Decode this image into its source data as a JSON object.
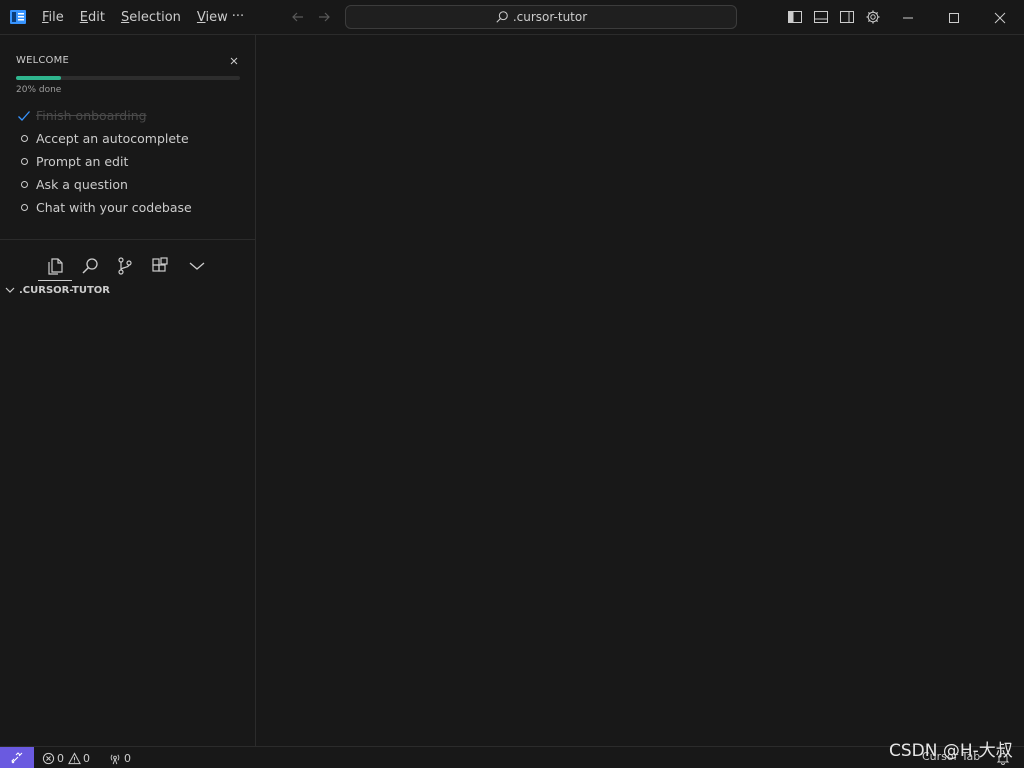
{
  "titlebar": {
    "menu": [
      {
        "accel": "F",
        "rest": "ile"
      },
      {
        "accel": "E",
        "rest": "dit"
      },
      {
        "accel": "S",
        "rest": "election"
      },
      {
        "accel": "V",
        "rest": "iew"
      }
    ],
    "more_label": "···",
    "search_text": ".cursor-tutor"
  },
  "welcome": {
    "title": "WELCOME",
    "progress_percent": 20,
    "progress_text": "20% done",
    "tasks": [
      {
        "label": "Finish onboarding",
        "done": true
      },
      {
        "label": "Accept an autocomplete",
        "done": false
      },
      {
        "label": "Prompt an edit",
        "done": false
      },
      {
        "label": "Ask a question",
        "done": false
      },
      {
        "label": "Chat with your codebase",
        "done": false
      }
    ]
  },
  "explorer": {
    "folder_name": ".CURSOR-TUTOR"
  },
  "statusbar": {
    "errors": "0",
    "warnings": "0",
    "ports": "0",
    "cursor_tab": "Cursor Tab"
  },
  "watermark": "CSDN @H-大叔",
  "colors": {
    "background": "#181818",
    "accent_remote": "#6a5ae0",
    "progress": "#2fb58e",
    "check": "#3794ff"
  }
}
